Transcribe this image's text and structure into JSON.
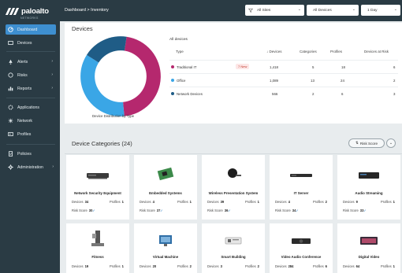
{
  "brand": {
    "name": "paloalto",
    "sub": "NETWORKS"
  },
  "sidebar": {
    "items": [
      {
        "label": "Dashboard",
        "icon": "dashboard-icon"
      },
      {
        "label": "Devices",
        "icon": "devices-icon"
      },
      {
        "label": "Alerts",
        "icon": "alert-icon"
      },
      {
        "label": "Risks",
        "icon": "risk-icon"
      },
      {
        "label": "Reports",
        "icon": "chart-icon"
      },
      {
        "label": "Applications",
        "icon": "apps-icon"
      },
      {
        "label": "Network",
        "icon": "network-icon"
      },
      {
        "label": "Profiles",
        "icon": "profile-icon"
      },
      {
        "label": "Policies",
        "icon": "policy-icon"
      },
      {
        "label": "Administration",
        "icon": "gear-icon"
      }
    ]
  },
  "header": {
    "breadcrumb": "Dashboard > Inventory",
    "filters": [
      "All Sites",
      "All Devices",
      "1 Day"
    ]
  },
  "devices": {
    "title": "Devices",
    "caption": "Device Distribution by Type",
    "table_caption": "All devices",
    "columns": [
      "Type",
      "Devices",
      "Categories",
      "Profiles",
      "Devices at Risk"
    ],
    "rows": [
      {
        "type": "Traditional IT",
        "badge": "7 New",
        "devices": "1,418",
        "categories": "5",
        "profiles": "18",
        "risk": "6",
        "color": "#b5286e"
      },
      {
        "type": "Office",
        "badge": "",
        "devices": "1,089",
        "categories": "13",
        "profiles": "24",
        "risk": "2",
        "color": "#3aa6e6"
      },
      {
        "type": "Network Devices",
        "badge": "",
        "devices": "566",
        "categories": "2",
        "profiles": "6",
        "risk": "3",
        "color": "#1f5c86"
      }
    ]
  },
  "chart_data": {
    "type": "pie",
    "categories": [
      "Traditional IT",
      "Office",
      "Network Devices"
    ],
    "values": [
      1418,
      1089,
      566
    ],
    "title": "",
    "colors": [
      "#b5286e",
      "#3aa6e6",
      "#1f5c86"
    ]
  },
  "categories": {
    "title": "Device Categories (24)",
    "risk_button": "Risk Score",
    "devices_label": "Devices",
    "profiles_label": "Profiles",
    "risk_label": "Risk Score",
    "tiles": [
      {
        "name": "Network Security Equipment",
        "devices": "34",
        "profiles": "1",
        "risk": "30"
      },
      {
        "name": "Embedded Systems",
        "devices": "4",
        "profiles": "1",
        "risk": "37"
      },
      {
        "name": "Wireless Presentation System",
        "devices": "39",
        "profiles": "1",
        "risk": "36"
      },
      {
        "name": "IT Server",
        "devices": "4",
        "profiles": "2",
        "risk": "34"
      },
      {
        "name": "Audio Streaming",
        "devices": "9",
        "profiles": "1",
        "risk": "33"
      },
      {
        "name": "Fitness",
        "devices": "19",
        "profiles": "1"
      },
      {
        "name": "Virtual Machine",
        "devices": "20",
        "profiles": "2"
      },
      {
        "name": "Smart Building",
        "devices": "3",
        "profiles": "2"
      },
      {
        "name": "Video Audio Conference",
        "devices": "284",
        "profiles": "6"
      },
      {
        "name": "Digital Video",
        "devices": "64",
        "profiles": "1"
      }
    ]
  }
}
